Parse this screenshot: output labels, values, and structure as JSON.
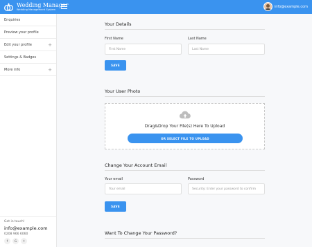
{
  "brand": {
    "title": "Wedding Manager",
    "subtitle": "Wedding Management System"
  },
  "header": {
    "menu_icon": "hamburger-icon",
    "user_email": "info@example.com"
  },
  "sidebar": {
    "items": [
      {
        "label": "Enquiries",
        "expandable": false
      },
      {
        "label": "Preview your profile",
        "expandable": false
      },
      {
        "label": "Edit your profile",
        "expandable": true,
        "toggle": "+"
      },
      {
        "label": "Settings & Badges",
        "expandable": false
      },
      {
        "label": "More info",
        "expandable": true,
        "toggle": "+"
      }
    ],
    "footer": {
      "label": "Get in touch!",
      "email": "info@example.com",
      "phone": "0208 966 6060",
      "socials": [
        {
          "icon": "facebook-icon",
          "glyph": "f"
        },
        {
          "icon": "google-plus-icon",
          "glyph": "G"
        },
        {
          "icon": "twitter-icon",
          "glyph": "t"
        }
      ]
    }
  },
  "details": {
    "title": "Your Details",
    "first_name_label": "First Name",
    "first_name_placeholder": "First Name",
    "last_name_label": "Last Name",
    "last_name_placeholder": "Last Name",
    "save_label": "SAVE"
  },
  "photo": {
    "title": "Your User Photo",
    "icon": "cloud-upload-icon",
    "drop_text": "Drag&Drop Your File(s) Here To Upload",
    "select_label": "OR SELECT FILE TO UPLOAD"
  },
  "email_change": {
    "title": "Change Your Account Email",
    "email_label": "Your email",
    "email_placeholder": "Your email",
    "password_label": "Password",
    "password_placeholder": "Security: Enter your password to confirm",
    "save_label": "SAVE"
  },
  "password_change": {
    "title": "Want To Change Your Password?"
  },
  "colors": {
    "accent": "#3a93ef",
    "main_bg": "#f7f8fa"
  }
}
